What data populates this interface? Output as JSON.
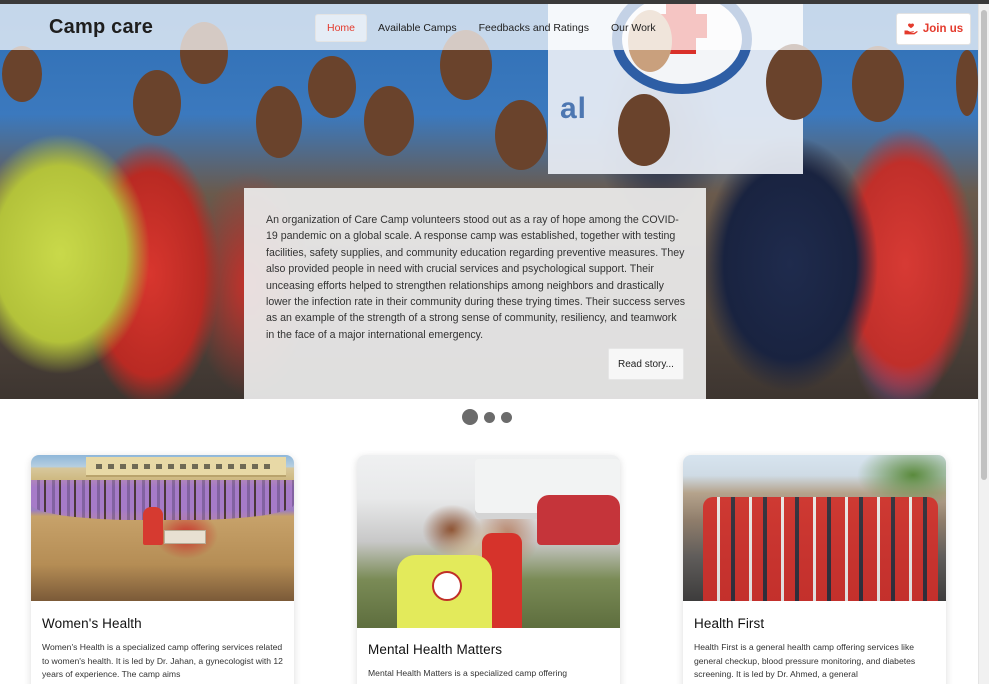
{
  "header": {
    "brand": "Camp care",
    "nav": [
      {
        "label": "Home",
        "active": true
      },
      {
        "label": "Available Camps",
        "active": false
      },
      {
        "label": "Feedbacks and Ratings",
        "active": false
      },
      {
        "label": "Our Work",
        "active": false
      }
    ],
    "join_label": "Join us",
    "join_icon": "hand-holding-heart-icon"
  },
  "hero": {
    "banner_text": "al",
    "story_text": "An organization of Care Camp volunteers stood out as a ray of hope among the COVID-19 pandemic on a global scale. A response camp was established, together with testing facilities, safety supplies, and community education regarding preventive measures. They also provided people in need with crucial services and psychological support. Their unceasing efforts helped to strengthen relationships among neighbors and drastically lower the infection rate in their community during these trying times. Their success serves as an example of the strength of a strong sense of community, resiliency, and teamwork in the face of a major international emergency.",
    "read_label": "Read story...",
    "slide_count": 3,
    "active_slide": 1
  },
  "cards": [
    {
      "title": "Women's Health",
      "text": "Women's Health is a specialized camp offering services related to women's health. It is led by Dr. Jahan, a gynecologist with 12 years of experience. The camp aims"
    },
    {
      "title": "Mental Health Matters",
      "text": "Mental Health Matters is a specialized camp offering"
    },
    {
      "title": "Health First",
      "text": "Health First is a general health camp offering services like general checkup, blood pressure monitoring, and diabetes screening. It is led by Dr. Ahmed, a general"
    }
  ],
  "colors": {
    "accent": "#e43a2c",
    "dot": "#6b6b6b"
  }
}
